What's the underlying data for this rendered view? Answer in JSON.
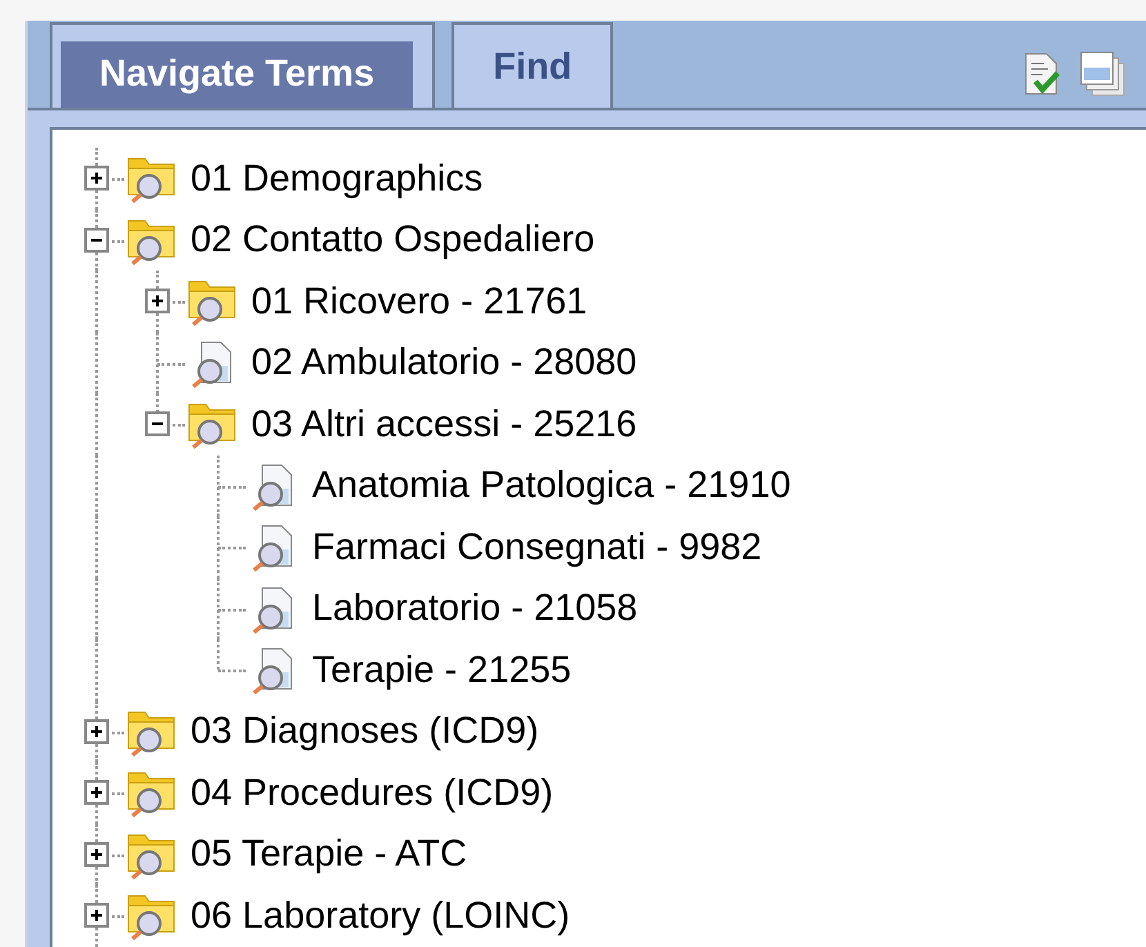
{
  "tabs": [
    {
      "label": "Navigate Terms",
      "selected": true
    },
    {
      "label": "Find",
      "selected": false
    }
  ],
  "tree": [
    {
      "label": "01 Demographics",
      "kind": "folder",
      "expanded": false
    },
    {
      "label": "02 Contatto Ospedaliero",
      "kind": "folder",
      "expanded": true,
      "children": [
        {
          "label": "01 Ricovero - 21761",
          "kind": "folder",
          "expanded": false
        },
        {
          "label": "02 Ambulatorio - 28080",
          "kind": "leaf"
        },
        {
          "label": "03 Altri accessi - 25216",
          "kind": "folder",
          "expanded": true,
          "children": [
            {
              "label": "Anatomia Patologica - 21910",
              "kind": "leaf"
            },
            {
              "label": "Farmaci Consegnati - 9982",
              "kind": "leaf"
            },
            {
              "label": "Laboratorio - 21058",
              "kind": "leaf"
            },
            {
              "label": "Terapie - 21255",
              "kind": "leaf"
            }
          ]
        }
      ]
    },
    {
      "label": "03 Diagnoses (ICD9)",
      "kind": "folder",
      "expanded": false
    },
    {
      "label": "04 Procedures (ICD9)",
      "kind": "folder",
      "expanded": false
    },
    {
      "label": "05 Terapie - ATC",
      "kind": "folder",
      "expanded": false
    },
    {
      "label": "06 Laboratory (LOINC)",
      "kind": "folder",
      "expanded": false
    }
  ]
}
